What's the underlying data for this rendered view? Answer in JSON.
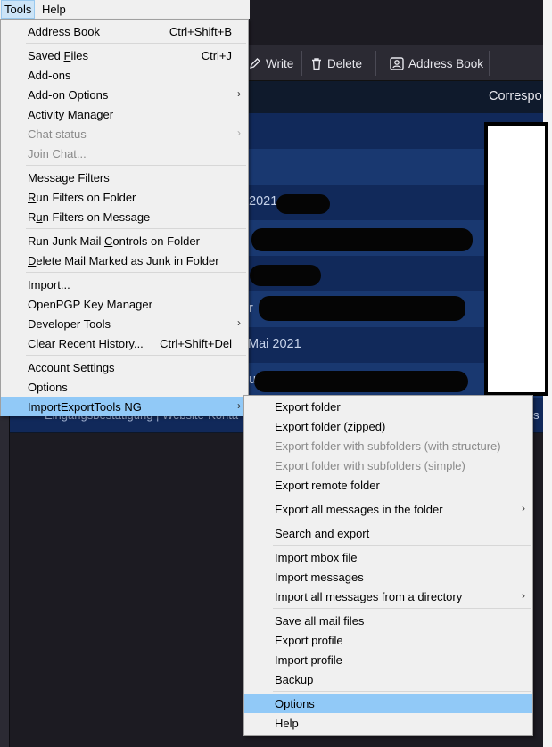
{
  "menubar": {
    "tools": "Tools",
    "help": "Help"
  },
  "toolbar": {
    "write": "Write",
    "delete": "Delete",
    "address_book": "Address Book"
  },
  "column_header": {
    "label": "Correspo"
  },
  "message_list": {
    "rows": [
      {
        "text": ""
      },
      {
        "text": "2021,"
      },
      {
        "text": ""
      },
      {
        "text": ""
      },
      {
        "text": "r"
      },
      {
        "text": "Mai 2021"
      },
      {
        "text": "u"
      }
    ],
    "ghost_text": "Eingangsbestätigung | Website-Konta",
    "ghost_text_right": "s"
  },
  "tools_menu": {
    "address_book": {
      "label_pre": "Address ",
      "label_u": "B",
      "label_post": "ook",
      "shortcut": "Ctrl+Shift+B"
    },
    "saved_files": {
      "label_pre": "Saved ",
      "label_u": "F",
      "label_post": "iles",
      "shortcut": "Ctrl+J"
    },
    "add_ons": "Add-ons",
    "add_on_options": "Add-on Options",
    "activity_manager": "Activity Manager",
    "chat_status": "Chat status",
    "join_chat": "Join Chat...",
    "message_filters": "Message Filters",
    "run_filters_folder": {
      "label_u": "R",
      "label_post": "un Filters on Folder"
    },
    "run_filters_message": {
      "label_pre": "R",
      "label_u": "u",
      "label_post": "n Filters on Message"
    },
    "run_junk": {
      "label_pre": "Run Junk Mail ",
      "label_u": "C",
      "label_post": "ontrols on Folder"
    },
    "delete_junk": {
      "label_u": "D",
      "label_post": "elete Mail Marked as Junk in Folder"
    },
    "import": "Import...",
    "openpgp": "OpenPGP Key Manager",
    "developer_tools": "Developer Tools",
    "clear_history": {
      "label": "Clear Recent History...",
      "shortcut": "Ctrl+Shift+Del"
    },
    "account_settings": "Account Settings",
    "options": "Options",
    "importexport": "ImportExportTools NG"
  },
  "submenu": {
    "export_folder": "Export folder",
    "export_folder_zipped": "Export folder (zipped)",
    "export_subfolders_structure": "Export folder with subfolders (with structure)",
    "export_subfolders_simple": "Export folder with subfolders (simple)",
    "export_remote": "Export remote folder",
    "export_all_messages": "Export all messages in the folder",
    "search_export": "Search and export",
    "import_mbox": "Import mbox file",
    "import_messages": "Import messages",
    "import_all_dir": "Import all messages from a directory",
    "save_all_mail": "Save all mail files",
    "export_profile": "Export profile",
    "import_profile": "Import profile",
    "backup": "Backup",
    "options": "Options",
    "help": "Help"
  },
  "icons": {
    "write": "pencil-icon",
    "delete": "trash-icon",
    "address_book": "contact-card-icon",
    "submenu_arrow": "chevron-right-icon"
  },
  "colors": {
    "menu_bg": "#f0f0f0",
    "highlight": "#91c9f7",
    "list_row": "#193870",
    "list_row_alt": "#11295a"
  }
}
